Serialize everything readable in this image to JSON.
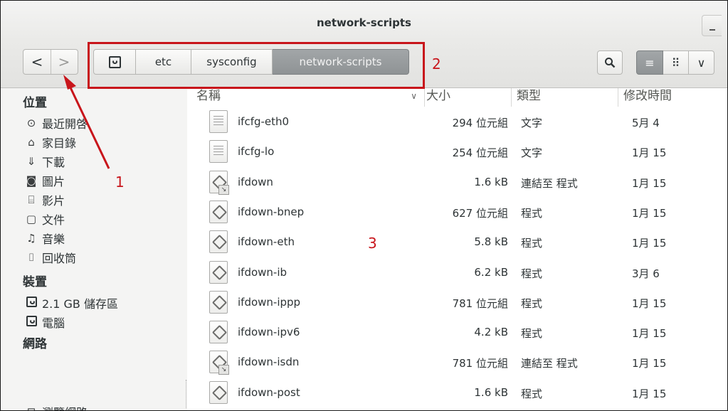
{
  "window": {
    "title": "network-scripts"
  },
  "toolbar": {
    "back_glyph": "<",
    "forward_glyph": ">",
    "breadcrumbs": [
      "etc",
      "sysconfig",
      "network-scripts"
    ],
    "search_icon": "search-icon",
    "list_view_glyph": "≡",
    "grid_view_glyph": "⠿",
    "menu_glyph": "∨"
  },
  "sidebar": {
    "places_heading": "位置",
    "places": [
      {
        "label": "最近開啓",
        "icon": "clock-icon",
        "glyph": "⊙"
      },
      {
        "label": "家目錄",
        "icon": "home-icon",
        "glyph": "⌂"
      },
      {
        "label": "下載",
        "icon": "download-icon",
        "glyph": "⇓"
      },
      {
        "label": "圖片",
        "icon": "camera-icon",
        "glyph": "◙"
      },
      {
        "label": "影片",
        "icon": "film-icon",
        "glyph": "⌸"
      },
      {
        "label": "文件",
        "icon": "document-icon",
        "glyph": "▢"
      },
      {
        "label": "音樂",
        "icon": "music-icon",
        "glyph": "♫"
      },
      {
        "label": "回收筒",
        "icon": "trash-icon",
        "glyph": "⌷"
      }
    ],
    "devices_heading": "裝置",
    "devices": [
      {
        "label": "2.1 GB 儲存區",
        "icon": "drive-icon"
      },
      {
        "label": "電腦",
        "icon": "computer-icon"
      }
    ],
    "network_heading": "網路",
    "network": [
      {
        "label": "瀏覽網路",
        "icon": "network-icon",
        "glyph": "⊟"
      }
    ]
  },
  "file_list": {
    "columns": {
      "name": "名稱",
      "size": "大小",
      "type": "類型",
      "modified": "修改時間"
    },
    "sort_indicator": "∨",
    "rows": [
      {
        "name": "ifcfg-eth0",
        "size": "294 位元組",
        "type": "文字",
        "modified": "5月 4",
        "icon": "text-file-icon"
      },
      {
        "name": "ifcfg-lo",
        "size": "254 位元組",
        "type": "文字",
        "modified": "1月 15",
        "icon": "text-file-icon"
      },
      {
        "name": "ifdown",
        "size": "1.6 kB",
        "type": "連結至 程式",
        "modified": "1月 15",
        "icon": "symlink-script-icon"
      },
      {
        "name": "ifdown-bnep",
        "size": "627 位元組",
        "type": "程式",
        "modified": "1月 15",
        "icon": "script-icon"
      },
      {
        "name": "ifdown-eth",
        "size": "5.8 kB",
        "type": "程式",
        "modified": "1月 15",
        "icon": "script-icon"
      },
      {
        "name": "ifdown-ib",
        "size": "6.2 kB",
        "type": "程式",
        "modified": "3月 6",
        "icon": "script-icon"
      },
      {
        "name": "ifdown-ippp",
        "size": "781 位元組",
        "type": "程式",
        "modified": "1月 15",
        "icon": "script-icon"
      },
      {
        "name": "ifdown-ipv6",
        "size": "4.2 kB",
        "type": "程式",
        "modified": "1月 15",
        "icon": "script-icon"
      },
      {
        "name": "ifdown-isdn",
        "size": "781 位元組",
        "type": "連結至 程式",
        "modified": "1月 15",
        "icon": "symlink-script-icon"
      },
      {
        "name": "ifdown-post",
        "size": "1.6 kB",
        "type": "程式",
        "modified": "1月 15",
        "icon": "script-icon"
      }
    ]
  },
  "annotations": {
    "label_1": "1",
    "label_2": "2",
    "label_3": "3",
    "color": "#c8151b"
  }
}
